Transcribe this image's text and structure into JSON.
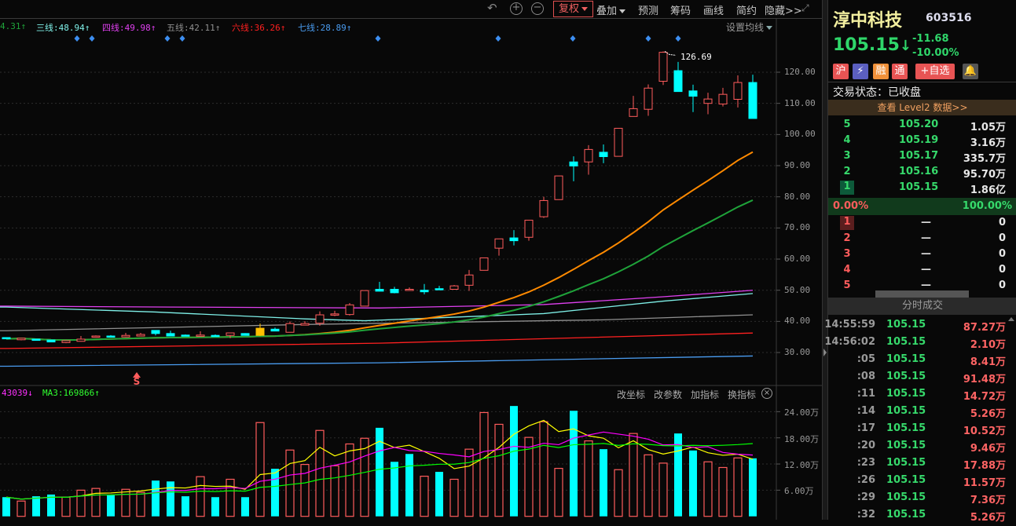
{
  "toolbar": {
    "undo_icon": "undo-icon",
    "zoom_in_icon": "zoom-in-icon",
    "zoom_out_icon": "zoom-out-icon",
    "fuquan": "复权",
    "overlay": "叠加",
    "forecast": "预测",
    "chips": "筹码",
    "draw": "画线",
    "simple": "简约",
    "hide": "隐藏>>",
    "fullscreen_icon": "fullscreen-icon"
  },
  "ma_labels": [
    {
      "text": "4.31↑",
      "color": "#1fa33a"
    },
    {
      "text": "三线:48.94↑",
      "color": "#7ff0e8"
    },
    {
      "text": "四线:49.98↑",
      "color": "#e040f0"
    },
    {
      "text": "五线:42.11↑",
      "color": "#909090"
    },
    {
      "text": "六线:36.26↑",
      "color": "#ff2020"
    },
    {
      "text": "七线:28.89↑",
      "color": "#4a9cf0"
    }
  ],
  "set_ma": "设置均线",
  "high_label": "126.69",
  "signal_label": "S",
  "price_axis": [
    "120.00",
    "110.00",
    "100.00",
    "90.00",
    "80.00",
    "70.00",
    "60.00",
    "50.00",
    "40.00",
    "30.00"
  ],
  "vol_axis": [
    "24.00万",
    "18.00万",
    "12.00万",
    "6.00万"
  ],
  "vol_header": {
    "ma_a": "43039↓",
    "ma3": "MA3:169866↑",
    "change_axis": "改坐标",
    "change_params": "改参数",
    "add_indicator": "加指标",
    "swap_indicator": "换指标"
  },
  "colors": {
    "up": "#ff5c5c",
    "down": "#00ffff",
    "limit": "#ffc000",
    "ma1": "#ff8a00",
    "ma2": "#1fa33a",
    "volma5": "#ffff00",
    "volma10": "#ff00ff",
    "volma20": "#00ff00"
  },
  "chart_data": {
    "type": "candlestick",
    "price_range": [
      24,
      128
    ],
    "candles": [
      [
        34.8,
        34.9,
        34.3,
        34.4
      ],
      [
        34.1,
        34.7,
        33.9,
        34.6
      ],
      [
        34.3,
        34.4,
        33.8,
        33.9
      ],
      [
        34.0,
        34.1,
        33.3,
        33.4
      ],
      [
        33.2,
        33.9,
        33.0,
        33.8
      ],
      [
        33.6,
        35.3,
        33.5,
        34.3
      ],
      [
        35.0,
        35.5,
        34.9,
        35.3
      ],
      [
        35.3,
        35.6,
        35.0,
        35.1
      ],
      [
        35.0,
        36.3,
        34.9,
        35.5
      ],
      [
        35.3,
        36.3,
        35.2,
        35.8
      ],
      [
        37.1,
        37.2,
        35.5,
        36.1
      ],
      [
        36.1,
        37.0,
        35.2,
        35.3
      ],
      [
        35.6,
        35.8,
        35.3,
        35.4
      ],
      [
        35.2,
        36.8,
        35.1,
        35.6
      ],
      [
        35.5,
        35.8,
        35.3,
        35.4
      ],
      [
        35.5,
        36.3,
        34.6,
        36.3
      ],
      [
        36.1,
        36.2,
        35.4,
        35.5
      ],
      [
        35.5,
        39.3,
        35.3,
        37.8
      ],
      [
        37.5,
        38.0,
        36.8,
        36.9
      ],
      [
        36.5,
        40.0,
        36.5,
        39.3
      ],
      [
        38.8,
        40.1,
        38.7,
        39.3
      ],
      [
        39.4,
        43.2,
        38.6,
        42.1
      ],
      [
        42.0,
        43.4,
        41.7,
        42.4
      ],
      [
        42.2,
        45.9,
        41.9,
        45.3
      ],
      [
        44.9,
        49.9,
        44.9,
        49.9
      ],
      [
        50.3,
        52.7,
        49.6,
        49.7
      ],
      [
        50.3,
        51.1,
        49.0,
        49.2
      ],
      [
        50.0,
        50.9,
        49.8,
        50.3
      ],
      [
        50.0,
        52.0,
        48.7,
        49.5
      ],
      [
        50.5,
        51.4,
        50.1,
        50.3
      ],
      [
        50.3,
        51.7,
        50.2,
        51.4
      ],
      [
        51.6,
        56.5,
        49.8,
        54.9
      ],
      [
        56.4,
        60.4,
        56.4,
        60.4
      ],
      [
        63.5,
        66.5,
        61.1,
        66.5
      ],
      [
        66.8,
        69.3,
        64.4,
        65.9
      ],
      [
        67.0,
        72.5,
        65.9,
        72.5
      ],
      [
        73.6,
        80.0,
        73.2,
        78.8
      ],
      [
        79.1,
        86.7,
        79.1,
        86.7
      ],
      [
        91.2,
        93.0,
        85.0,
        89.9
      ],
      [
        91.2,
        96.6,
        87.1,
        95.2
      ],
      [
        94.3,
        96.8,
        90.8,
        92.9
      ],
      [
        93.0,
        102.0,
        93.0,
        102.0
      ],
      [
        105.8,
        112.4,
        105.8,
        108.3
      ],
      [
        108.1,
        116.1,
        106.0,
        114.9
      ],
      [
        117.1,
        126.69,
        115.9,
        126.4
      ],
      [
        120.5,
        123.3,
        113.8,
        113.8
      ],
      [
        114.0,
        116.0,
        107.2,
        112.3
      ],
      [
        110.0,
        113.4,
        106.5,
        111.4
      ],
      [
        109.8,
        115.0,
        109.0,
        112.9
      ],
      [
        111.3,
        119.0,
        108.7,
        116.7
      ],
      [
        116.7,
        119.2,
        105.15,
        105.15
      ]
    ],
    "limit_index": 17,
    "ma_periods": [
      20,
      30
    ],
    "long_ma": [
      {
        "name": "三线",
        "color": "#7ff0e8",
        "points": [
          [
            0,
            44.6
          ],
          [
            10,
            43.0
          ],
          [
            20,
            40.8
          ],
          [
            24,
            40.2
          ],
          [
            36,
            42.5
          ],
          [
            44,
            46.5
          ],
          [
            50,
            48.94
          ]
        ]
      },
      {
        "name": "四线",
        "color": "#e040f0",
        "points": [
          [
            0,
            44.9
          ],
          [
            11,
            44.6
          ],
          [
            25,
            44.3
          ],
          [
            36,
            45.4
          ],
          [
            44,
            47.9
          ],
          [
            50,
            49.98
          ]
        ]
      },
      {
        "name": "五线",
        "color": "#909090",
        "points": [
          [
            0,
            37.0
          ],
          [
            20,
            39.0
          ],
          [
            40,
            40.5
          ],
          [
            50,
            42.11
          ]
        ]
      },
      {
        "name": "六线",
        "color": "#ff2020",
        "points": [
          [
            0,
            31.3
          ],
          [
            25,
            33.0
          ],
          [
            50,
            36.26
          ]
        ]
      },
      {
        "name": "七线",
        "color": "#4a9cf0",
        "points": [
          [
            0,
            25.6
          ],
          [
            25,
            26.7
          ],
          [
            50,
            28.89
          ]
        ]
      }
    ],
    "volume_unit": "万",
    "volume_range": [
      0,
      26.5
    ],
    "volumes": [
      4.4,
      3.5,
      4.6,
      5.0,
      4.4,
      6.0,
      6.4,
      5.0,
      6.2,
      5.5,
      8.2,
      8.0,
      4.6,
      9.1,
      4.4,
      8.5,
      4.4,
      21.5,
      10.9,
      15.2,
      11.9,
      19.7,
      11.6,
      16.6,
      17.9,
      20.3,
      12.5,
      14.3,
      9.2,
      10.2,
      8.5,
      15.4,
      23.8,
      21.1,
      25.3,
      18.1,
      21.7,
      11.0,
      24.2,
      17.3,
      15.4,
      10.7,
      19.0,
      14.1,
      12.2,
      19.0,
      15.1,
      12.5,
      11.2,
      13.4,
      13.3
    ],
    "volume_up": [
      0,
      1,
      0,
      0,
      1,
      1,
      1,
      0,
      1,
      1,
      0,
      0,
      0,
      1,
      0,
      1,
      0,
      1,
      0,
      1,
      1,
      1,
      1,
      1,
      1,
      0,
      0,
      0,
      1,
      0,
      1,
      1,
      1,
      1,
      0,
      1,
      1,
      1,
      0,
      1,
      0,
      1,
      1,
      1,
      1,
      0,
      0,
      1,
      1,
      1,
      0
    ],
    "vol_ma_periods": [
      5,
      10,
      20
    ]
  },
  "stock": {
    "name": "淳中科技",
    "code": "603516",
    "price": "105.15",
    "arrow": "↓",
    "change": "-11.68",
    "change_pct": "-10.00%",
    "badges": [
      "沪",
      "⚡",
      "融",
      "通"
    ],
    "add_watch": "+自选",
    "bell_icon": "bell-icon",
    "status": "交易状态：已收盘",
    "level2": "查看 Level2 数据>>"
  },
  "orderbook": {
    "sell": [
      {
        "lvl": "5",
        "price": "105.20",
        "vol": "1.05万"
      },
      {
        "lvl": "4",
        "price": "105.19",
        "vol": "3.16万"
      },
      {
        "lvl": "3",
        "price": "105.17",
        "vol": "335.7万"
      },
      {
        "lvl": "2",
        "price": "105.16",
        "vol": "95.70万"
      },
      {
        "lvl": "1",
        "price": "105.15",
        "vol": "1.86亿"
      }
    ],
    "ratio_left": "0.00%",
    "ratio_right": "100.00%",
    "buy": [
      {
        "lvl": "1",
        "price": "—",
        "vol": "0"
      },
      {
        "lvl": "2",
        "price": "—",
        "vol": "0"
      },
      {
        "lvl": "3",
        "price": "—",
        "vol": "0"
      },
      {
        "lvl": "4",
        "price": "—",
        "vol": "0"
      },
      {
        "lvl": "5",
        "price": "—",
        "vol": "0"
      }
    ]
  },
  "trades": {
    "title": "分时成交",
    "rows": [
      {
        "t": "14:55:59",
        "p": "105.15",
        "v": "87.27万"
      },
      {
        "t": "14:56:02",
        "p": "105.15",
        "v": "2.10万"
      },
      {
        "t": ":05",
        "p": "105.15",
        "v": "8.41万"
      },
      {
        "t": ":08",
        "p": "105.15",
        "v": "91.48万"
      },
      {
        "t": ":11",
        "p": "105.15",
        "v": "14.72万"
      },
      {
        "t": ":14",
        "p": "105.15",
        "v": "5.26万"
      },
      {
        "t": ":17",
        "p": "105.15",
        "v": "10.52万"
      },
      {
        "t": ":20",
        "p": "105.15",
        "v": "9.46万"
      },
      {
        "t": ":23",
        "p": "105.15",
        "v": "17.88万"
      },
      {
        "t": ":26",
        "p": "105.15",
        "v": "11.57万"
      },
      {
        "t": ":29",
        "p": "105.15",
        "v": "7.36万"
      },
      {
        "t": ":32",
        "p": "105.15",
        "v": "5.26万"
      }
    ]
  }
}
